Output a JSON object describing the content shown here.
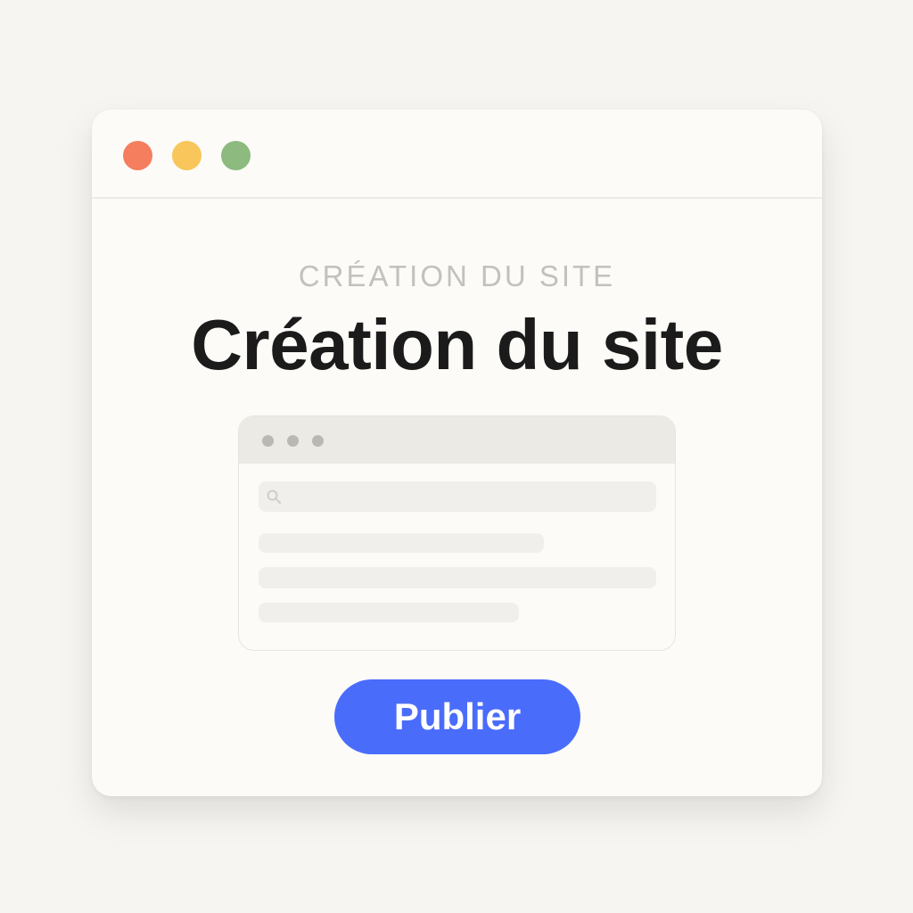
{
  "window": {
    "traffic_lights": {
      "close_color": "#f47e5d",
      "minimize_color": "#f8c65a",
      "maximize_color": "#8cba7f"
    }
  },
  "header": {
    "eyebrow": "CRÉATION DU SITE",
    "title": "Création du site"
  },
  "mockup": {
    "search_icon": "search-icon"
  },
  "actions": {
    "publish_label": "Publier",
    "publish_color": "#4a6cfb"
  }
}
